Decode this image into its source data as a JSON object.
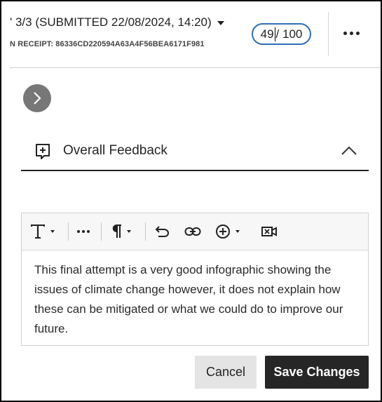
{
  "header": {
    "attempt_label": "' 3/3 (SUBMITTED 22/08/2024, 14:20)",
    "receipt_label": "N RECEIPT: 86336CD220594A63A4F56BEA6171F981",
    "grade_value": "49",
    "grade_max": "/ 100"
  },
  "feedback": {
    "title": "Overall Feedback",
    "text": "This final attempt is a very good infographic showing the issues of climate change however, it does not explain how these can be mitigated or what we could do to improve our future."
  },
  "toolbar": {
    "items": [
      "text-style",
      "more-options",
      "paragraph",
      "undo",
      "insert-link",
      "insert-content",
      "record-video"
    ]
  },
  "actions": {
    "cancel_label": "Cancel",
    "save_label": "Save Changes"
  },
  "colors": {
    "accent_blue": "#2f6fb6",
    "primary_dark": "#262626",
    "chevron_grey": "#777777"
  }
}
